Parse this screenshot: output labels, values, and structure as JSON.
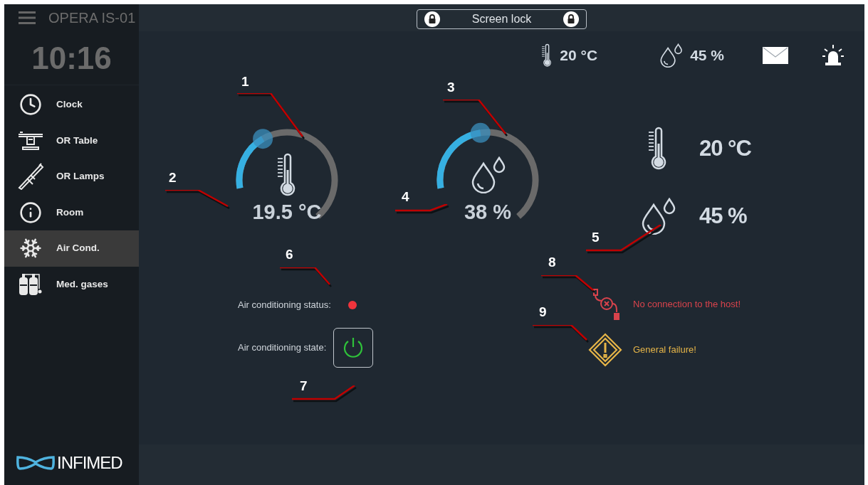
{
  "sidebar": {
    "title": "OPERA IS-01",
    "time": "10:16",
    "items": [
      {
        "label": "Clock",
        "selected": false
      },
      {
        "label": "OR Table",
        "selected": false
      },
      {
        "label": "OR Lamps",
        "selected": false
      },
      {
        "label": "Room",
        "selected": false
      },
      {
        "label": "Air Cond.",
        "selected": true
      },
      {
        "label": "Med. gases",
        "selected": false
      }
    ],
    "logo": "INFIMED"
  },
  "top_bar": {
    "screen_lock": "Screen lock"
  },
  "status": [
    {
      "kind": "temperature",
      "value": "20 °C"
    },
    {
      "kind": "humidity",
      "value": "45 %"
    }
  ],
  "gauges": [
    {
      "kind": "temperature",
      "value": "19.5 °C"
    },
    {
      "kind": "humidity",
      "value": "38 %"
    }
  ],
  "readings": [
    {
      "kind": "temperature",
      "value": "20 °C"
    },
    {
      "kind": "humidity",
      "value": "45 %"
    }
  ],
  "ac": {
    "status_label": "Air conditioning status:",
    "status_ok": false,
    "state_label": "Air conditioning state:",
    "on": true
  },
  "alerts": [
    {
      "kind": "error",
      "text": "No connection to the host!"
    },
    {
      "kind": "warning",
      "text": "General failure!"
    }
  ],
  "callouts": [
    {
      "label": "1"
    },
    {
      "label": "2"
    },
    {
      "label": "3"
    },
    {
      "label": "4"
    },
    {
      "label": "5"
    },
    {
      "label": "6"
    },
    {
      "label": "7"
    },
    {
      "label": "8"
    },
    {
      "label": "9"
    }
  ]
}
